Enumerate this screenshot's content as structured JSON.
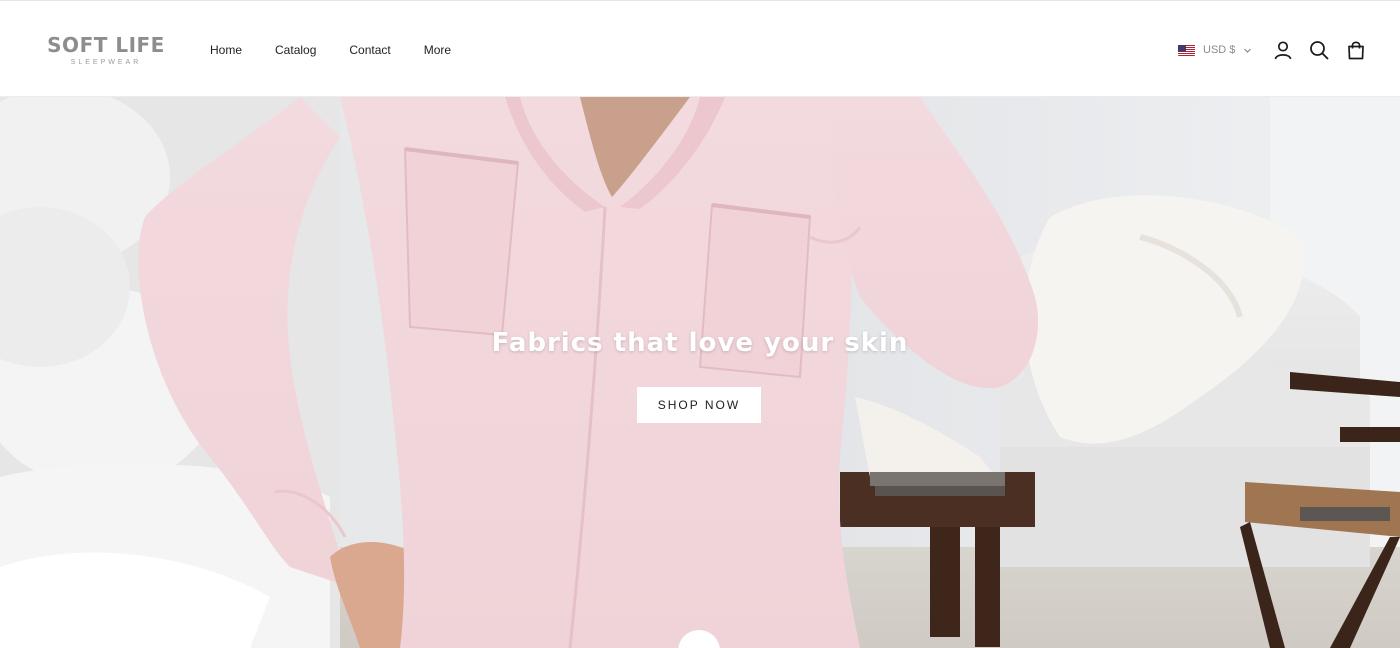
{
  "brand": {
    "name": "SOFT LIFE",
    "tagline": "SLEEPWEAR"
  },
  "nav": {
    "items": [
      {
        "label": "Home"
      },
      {
        "label": "Catalog"
      },
      {
        "label": "Contact"
      },
      {
        "label": "More"
      }
    ]
  },
  "header_actions": {
    "currency": "USD $",
    "currency_flag_icon": "us-flag-icon",
    "icons": [
      "account-icon",
      "search-icon",
      "cart-bag-icon"
    ]
  },
  "hero": {
    "headline": "Fabrics that love your skin",
    "cta_label": "SHOP NOW",
    "mute_icon": "sound-muted-icon"
  },
  "colors": {
    "logo": "#8d8d8d",
    "nav_text": "#1f1f1f",
    "currency_text": "#8a8a8a",
    "cta_background": "#ffffff",
    "headline_text": "#ffffff",
    "pajama_pink": "#f2d6db"
  }
}
